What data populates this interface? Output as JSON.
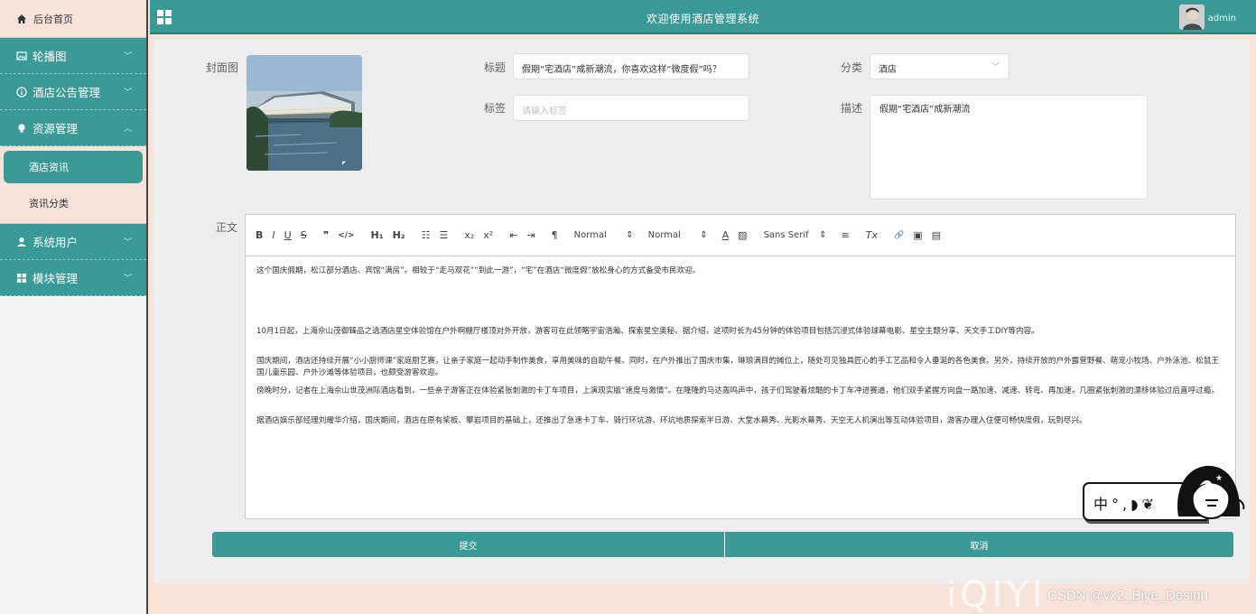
{
  "sidebar": {
    "home": "后台首页",
    "menu": [
      {
        "label": "轮播图",
        "icon": "image-icon"
      },
      {
        "label": "酒店公告管理",
        "icon": "info-icon"
      },
      {
        "label": "资源管理",
        "icon": "bulb-icon"
      },
      {
        "label": "系统用户",
        "icon": "user-icon"
      },
      {
        "label": "模块管理",
        "icon": "grid-icon"
      }
    ],
    "submenu": [
      "酒店资讯",
      "资讯分类"
    ]
  },
  "header": {
    "title": "欢迎使用酒店管理系统",
    "user": "admin"
  },
  "form": {
    "cover_label": "封面图",
    "title_label": "标题",
    "title_value": "假期“宅酒店”成新潮流，你喜欢这样“微度假”吗？",
    "category_label": "分类",
    "category_value": "酒店",
    "tags_label": "标签",
    "tags_placeholder": "请输入标签",
    "desc_label": "描述",
    "desc_value": "假期“宅酒店”成新潮流",
    "body_label": "正文"
  },
  "toolbar": {
    "bold": "B",
    "italic": "I",
    "underline": "U",
    "strike": "S",
    "quote": "❞",
    "code": "</>",
    "h1": "H₁",
    "h2": "H₂",
    "ol": "☷",
    "ul": "☰",
    "sub": "x₂",
    "sup": "x²",
    "outdent": "⇤",
    "indent": "⇥",
    "rtl": "¶",
    "size_value": "Normal",
    "header_value": "Normal",
    "color": "A",
    "bg": "▨",
    "font_value": "Sans Serif",
    "align": "≡",
    "clean": "Tx",
    "link": "🔗",
    "image": "▣",
    "video": "▤"
  },
  "editor": {
    "paragraphs": [
      "这个国庆假期，松江部分酒店、宾馆“满房”。相较于“走马观花”“到此一游”，“宅”在酒店“微度假”放松身心的方式备受市民欢迎。",
      "",
      "10月1日起，上海佘山茂御臻品之选酒店星空体验馆在户外啊棚厅楼顶对外开放，游客可在此领略宇宙浩瀚、探索星空奥秘。据介绍，这项时长为45分钟的体验项目包括沉浸式体验球幕电影、星空主题分享、天文手工DIY等内容。",
      "国庆期间，酒店还持续开展“小小厨师课”家庭厨艺赛，让亲子家庭一起动手制作美食，享用美味的自助午餐。同时，在户外推出了国庆市集，琳琅满目的摊位上，随处可见独具匠心的手工艺品和令人垂涎的各色美食。另外，持续开放的户外露营野餐、萌宠小牧场、户外泳池、松鼠王国儿童乐园、户外沙滩等体验项目，也颇受游客欢迎。",
      "傍晚时分，记者在上海佘山世茂洲际酒店看到，一些亲子游客正在体验紧张刺激的卡丁车项目，上演现实版“速度与激情”。在隆隆的马达轰鸣声中，孩子们驾驶着炫酷的卡丁车冲进赛道，他们双手紧握方向盘一路加速、减速、转弯、再加速，几圈紧张刺激的漂移体验过后直呼过瘾。",
      "",
      "据酒店娱乐部经理刘耀华介绍，国庆期间，酒店在原有桨板、攀岩项目的基础上，还推出了急速卡丁车、骑行环坑游、环坑地质探索半日游、大堂水幕秀、光影水幕秀、天空无人机演出等互动体验项目，游客办理入住便可畅快度假，玩到尽兴。"
    ]
  },
  "buttons": {
    "submit": "提交",
    "cancel": "取消"
  },
  "ime": {
    "text": "中°,◗❦"
  },
  "watermarks": {
    "iqiyi": "iQIYI",
    "csdn": "CSDN @vx2_Biye_Design"
  },
  "colors": {
    "primary": "#3a9a95",
    "background": "#f8e3d9",
    "panel": "#eeeeee"
  }
}
